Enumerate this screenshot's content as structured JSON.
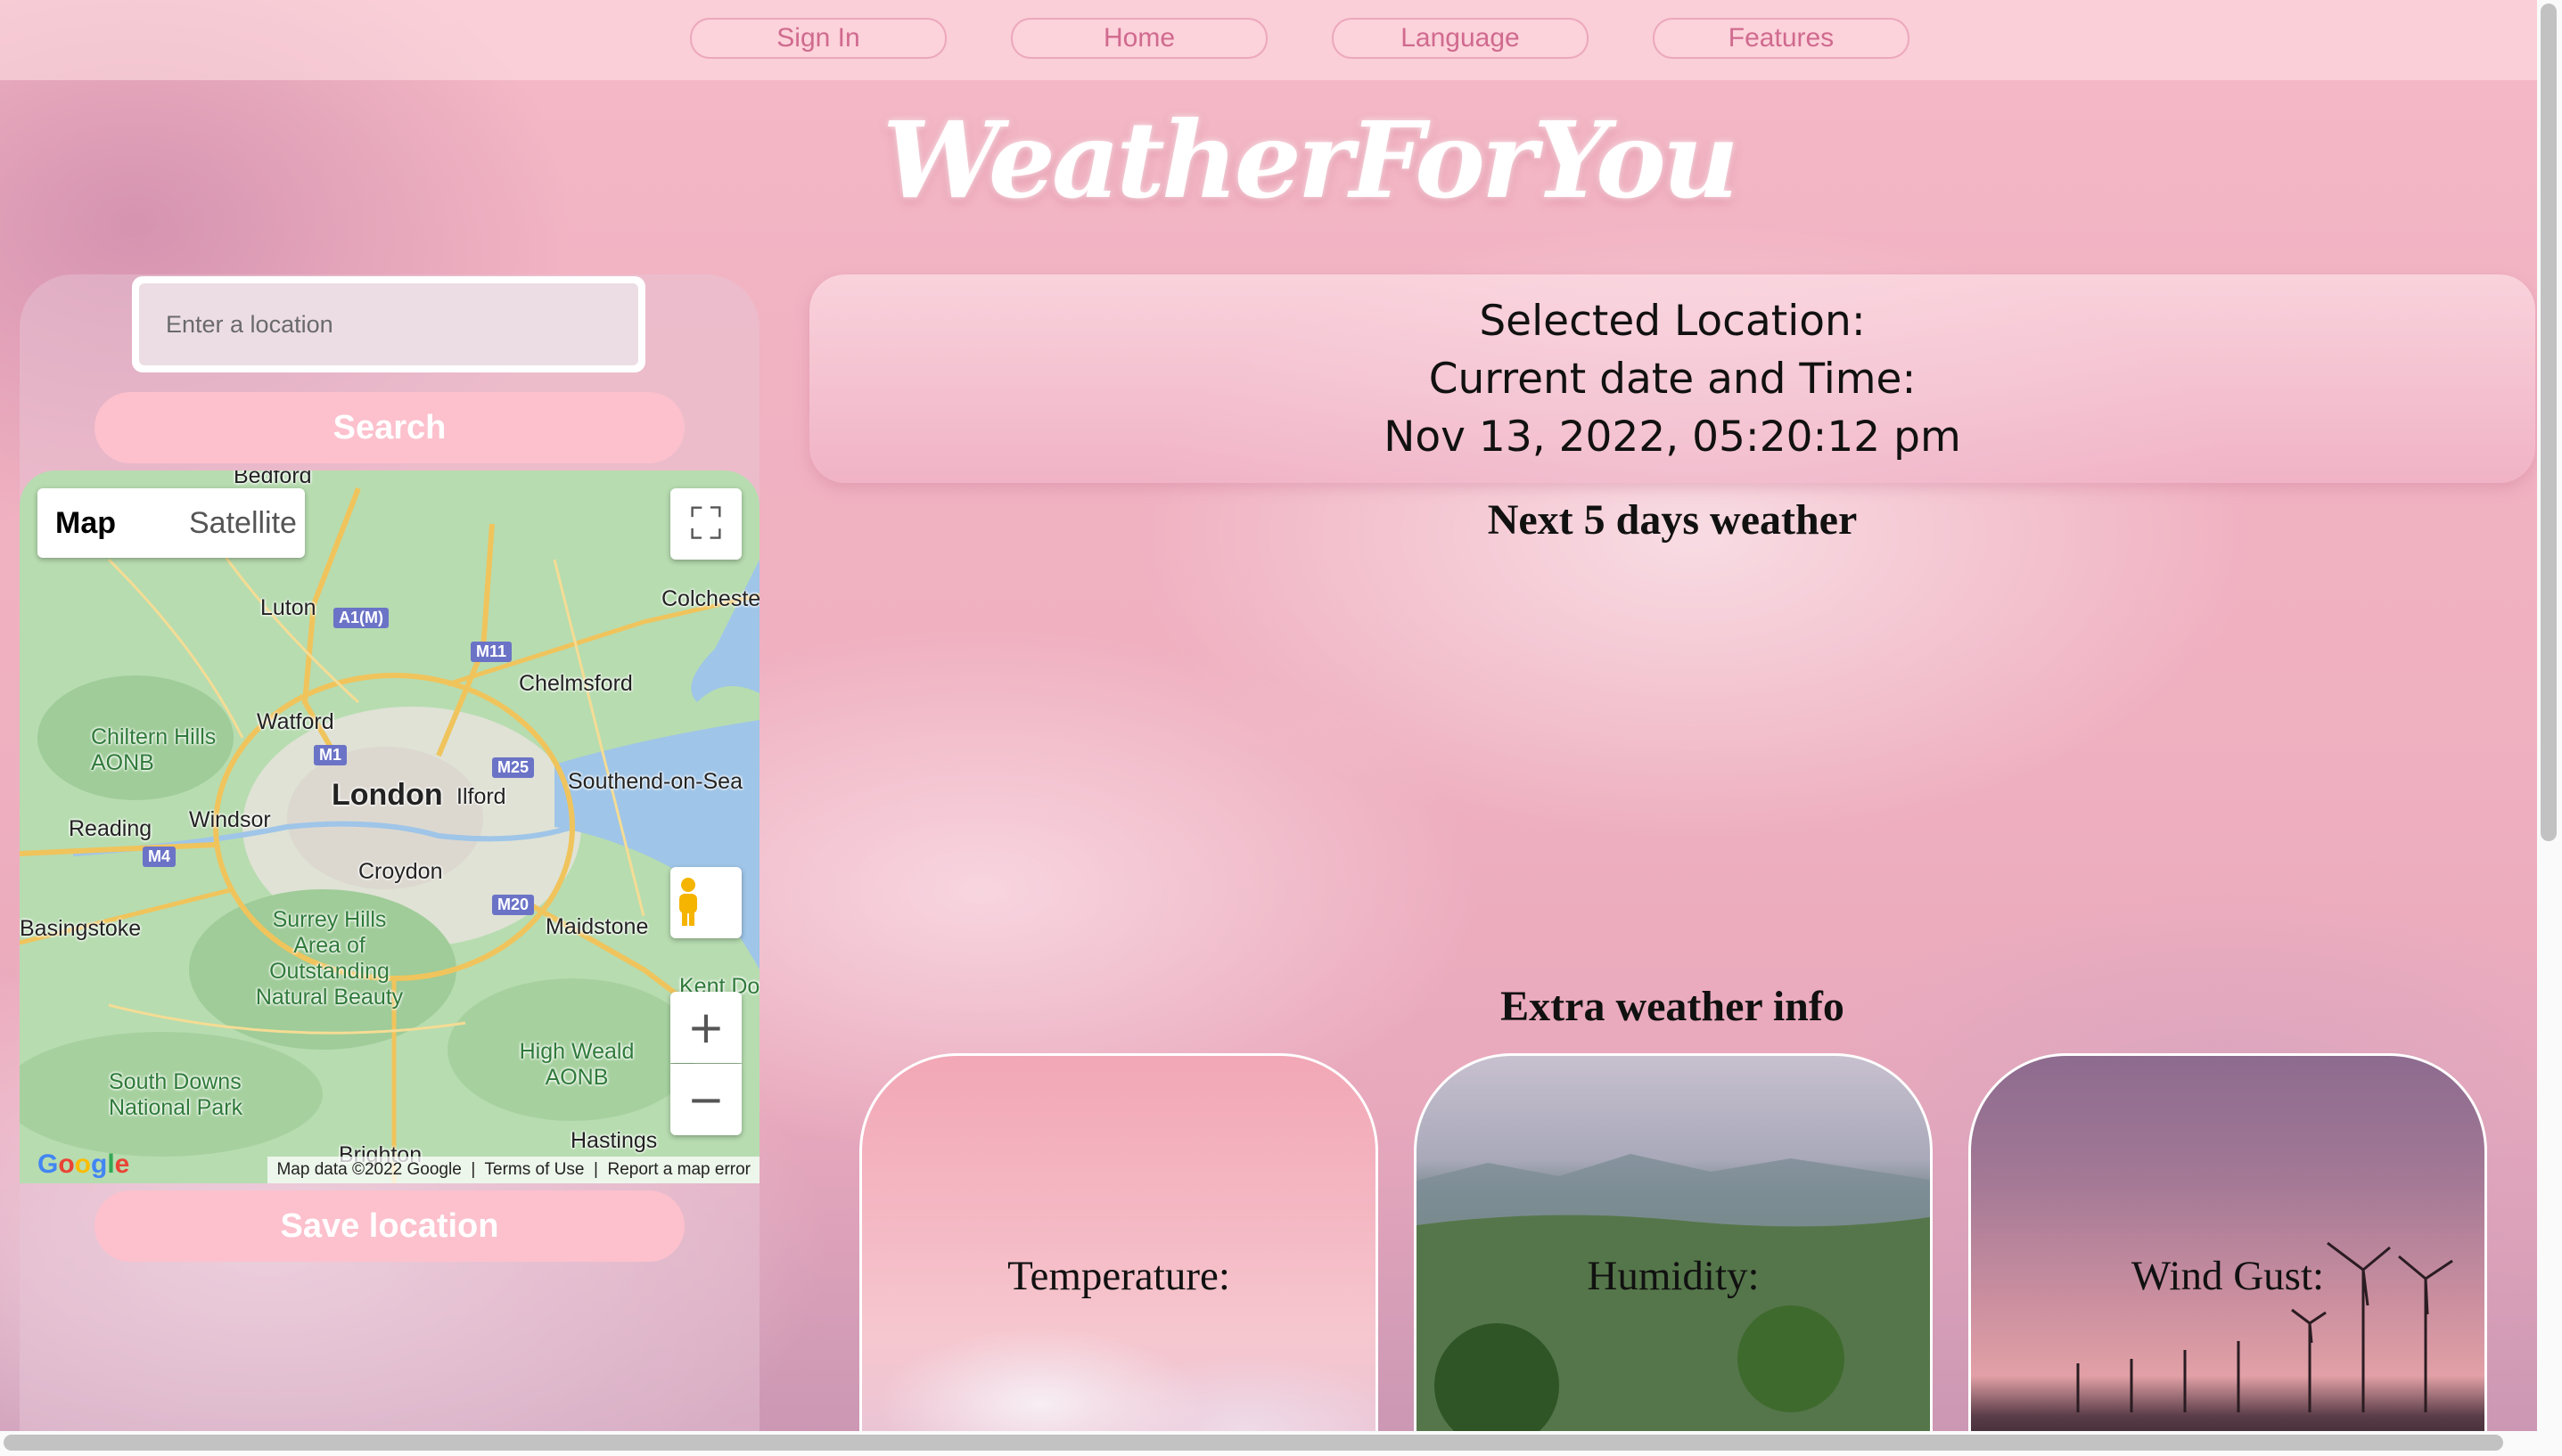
{
  "nav": {
    "items": [
      {
        "label": "Sign In"
      },
      {
        "label": "Home"
      },
      {
        "label": "Language"
      },
      {
        "label": "Features"
      }
    ]
  },
  "logo": {
    "text": "WeatherForYou"
  },
  "search": {
    "placeholder": "Enter a location",
    "button_label": "Search",
    "save_label": "Save location"
  },
  "map": {
    "type_buttons": [
      "Map",
      "Satellite"
    ],
    "places": [
      "Bedford",
      "Luton",
      "Colchester",
      "Chelmsford",
      "Watford",
      "London",
      "Ilford",
      "Southend-on-Sea",
      "Reading",
      "Windsor",
      "Croydon",
      "Basingstoke",
      "Maidstone",
      "Hastings",
      "Brighton"
    ],
    "parks": [
      "Chiltern Hills AONB",
      "Surrey Hills Area of Outstanding Natural Beauty",
      "High Weald AONB",
      "South Downs National Park",
      "Kent Downs"
    ],
    "roads": [
      "A1(M)",
      "M11",
      "M1",
      "M25",
      "M4",
      "M20"
    ],
    "attribution": {
      "data": "Map data ©2022 Google",
      "terms": "Terms of Use",
      "report": "Report a map error",
      "brand": "Google"
    },
    "icons": [
      "fullscreen-icon",
      "pegman-icon",
      "zoom-in-icon",
      "zoom-out-icon"
    ]
  },
  "location_card": {
    "selected_label": "Selected Location:",
    "datetime_label": "Current date and Time:",
    "datetime_value": "Nov 13, 2022, 05:20:12 pm"
  },
  "forecast": {
    "title": "Next 5 days weather"
  },
  "extra": {
    "title": "Extra weather info",
    "cards": [
      {
        "label": "Temperature:"
      },
      {
        "label": "Humidity:"
      },
      {
        "label": "Wind Gust:"
      }
    ]
  },
  "colors": {
    "accent_pink": "#fcc1cd",
    "nav_text": "#d06a8e",
    "map_green": "#b7dcb0",
    "water": "#9fc5e8"
  }
}
